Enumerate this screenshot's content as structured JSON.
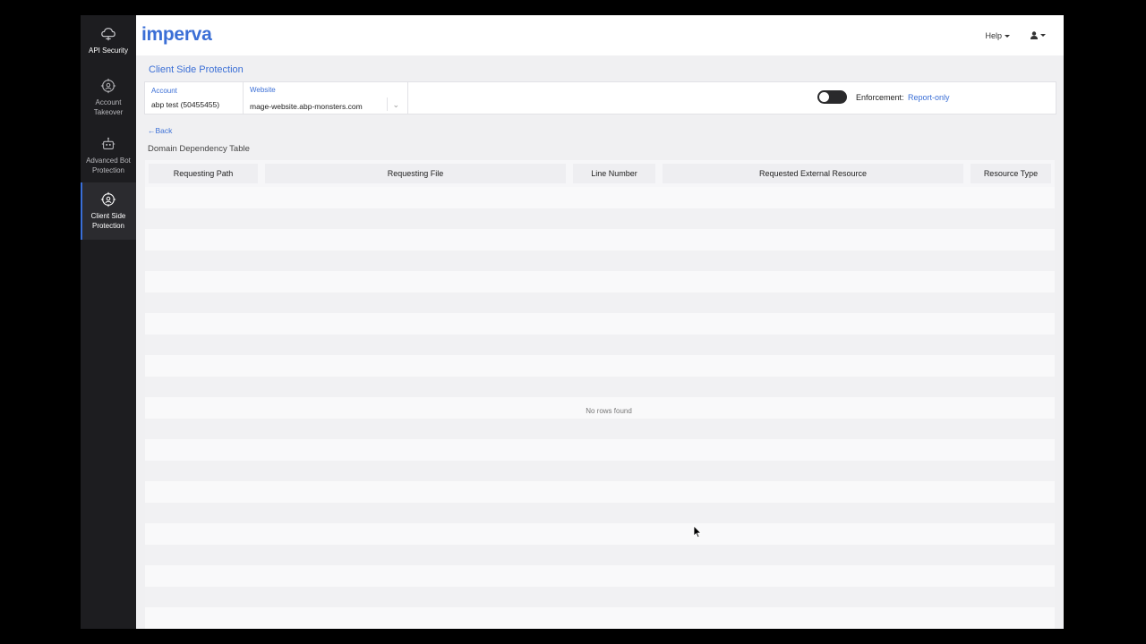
{
  "sidebar": {
    "items": [
      {
        "label": "API Security",
        "icon": "cloud-icon"
      },
      {
        "label": "Account Takeover",
        "icon": "target-icon"
      },
      {
        "label": "Advanced Bot Protection",
        "icon": "robot-icon"
      },
      {
        "label": "Client Side Protection",
        "icon": "shield-user-icon",
        "active": true
      }
    ]
  },
  "header": {
    "logo": "imperva",
    "help": "Help",
    "user_icon": "user-icon"
  },
  "page": {
    "title": "Client Side Protection",
    "back": "Back",
    "subtitle": "Domain Dependency Table"
  },
  "selectors": {
    "account_label": "Account",
    "account_value": "abp test (50455455)",
    "website_label": "Website",
    "website_value": "mage-website.abp-monsters.com"
  },
  "enforcement": {
    "label": "Enforcement:",
    "value": "Report-only"
  },
  "table": {
    "columns": [
      "Requesting Path",
      "Requesting File",
      "Line Number",
      "Requested External Resource",
      "Resource Type"
    ],
    "empty_message": "No rows found"
  },
  "colors": {
    "accent": "#3b6fd6",
    "sidebar_bg": "#1d1d20",
    "page_bg": "#f0f0f2"
  }
}
